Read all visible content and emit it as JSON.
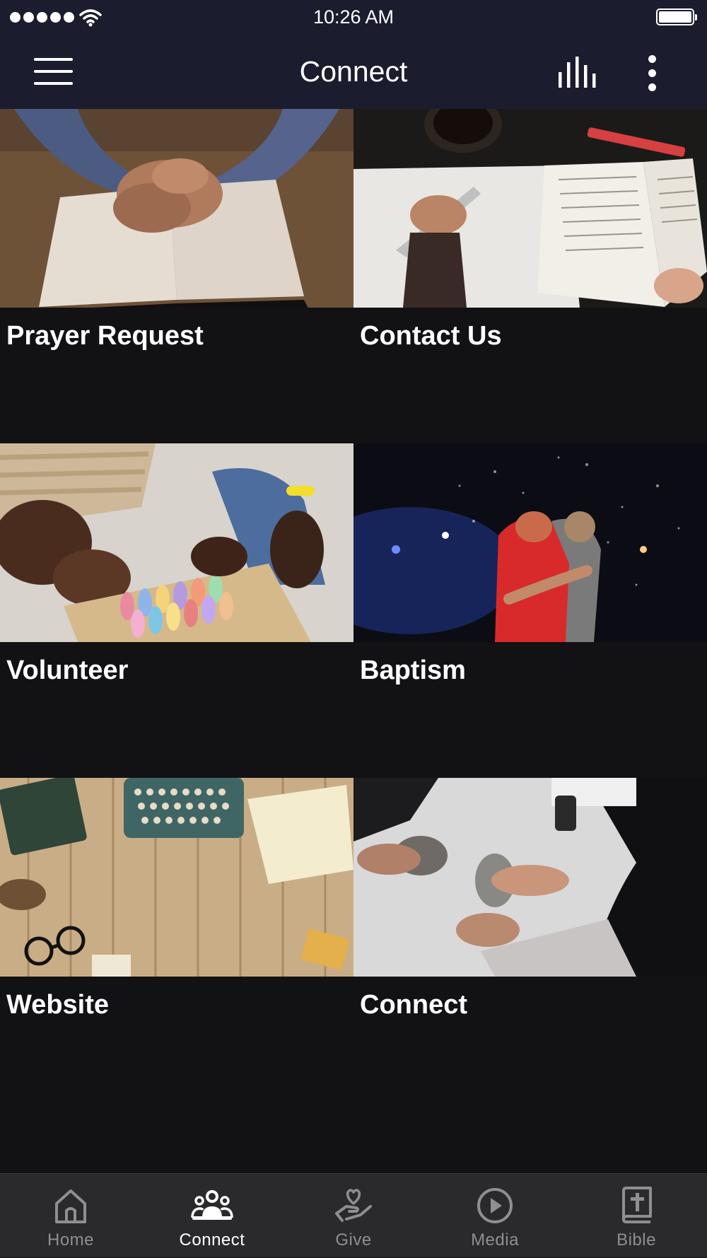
{
  "status_bar": {
    "time": "10:26 AM"
  },
  "app_bar": {
    "title": "Connect"
  },
  "cards": [
    {
      "label": "Prayer Request",
      "image": "hands-praying-over-bible"
    },
    {
      "label": "Contact Us",
      "image": "writing-notes-beside-bible"
    },
    {
      "label": "Volunteer",
      "image": "children-with-chalk-box"
    },
    {
      "label": "Baptism",
      "image": "people-hugging-in-water-spray"
    },
    {
      "label": "Website",
      "image": "typewriter-on-wooden-table"
    },
    {
      "label": "Connect",
      "image": "people-with-coffee-mugs"
    }
  ],
  "tab_bar": {
    "items": [
      {
        "label": "Home",
        "icon": "home-icon",
        "active": false
      },
      {
        "label": "Connect",
        "icon": "people-icon",
        "active": true
      },
      {
        "label": "Give",
        "icon": "heart-hand-icon",
        "active": false
      },
      {
        "label": "Media",
        "icon": "play-circle-icon",
        "active": false
      },
      {
        "label": "Bible",
        "icon": "bible-icon",
        "active": false
      }
    ]
  },
  "colors": {
    "app_bar": "#1b1c2e",
    "background": "#121214",
    "tab_bar": "#2a2a2c",
    "tab_inactive": "#8e8e93",
    "tab_active": "#ffffff"
  }
}
